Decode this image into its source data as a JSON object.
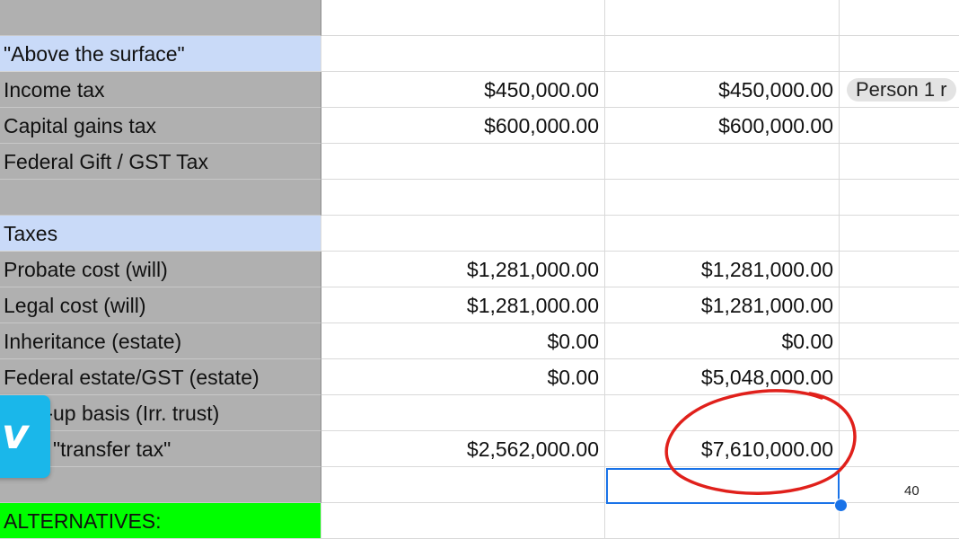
{
  "rows": [
    {
      "style": "gray",
      "label": "",
      "a": "",
      "b": "",
      "note": ""
    },
    {
      "style": "blue",
      "label": "\"Above the surface\"",
      "a": "",
      "b": "",
      "note": ""
    },
    {
      "style": "gray",
      "label": "Income tax",
      "a": "$450,000.00",
      "b": "$450,000.00",
      "note": "Person 1 r"
    },
    {
      "style": "gray",
      "label": "Capital gains tax",
      "a": "$600,000.00",
      "b": "$600,000.00",
      "note": ""
    },
    {
      "style": "gray",
      "label": "Federal Gift / GST Tax",
      "a": "",
      "b": "",
      "note": ""
    },
    {
      "style": "gray",
      "label": "",
      "a": "",
      "b": "",
      "note": ""
    },
    {
      "style": "blue",
      "label": "Taxes",
      "a": "",
      "b": "",
      "note": ""
    },
    {
      "style": "gray",
      "label": "Probate cost (will)",
      "a": "$1,281,000.00",
      "b": "$1,281,000.00",
      "note": ""
    },
    {
      "style": "gray",
      "label": "Legal cost (will)",
      "a": "$1,281,000.00",
      "b": "$1,281,000.00",
      "note": ""
    },
    {
      "style": "gray",
      "label": "Inheritance (estate)",
      "a": "$0.00",
      "b": "$0.00",
      "note": ""
    },
    {
      "style": "gray",
      "label": "Federal estate/GST (estate)",
      "a": "$0.00",
      "b": "$5,048,000.00",
      "note": ""
    },
    {
      "style": "gray",
      "label": "Step-up basis (Irr. trust)",
      "a": "",
      "b": "",
      "note": ""
    },
    {
      "style": "gray",
      "label": "Total \"transfer tax\"",
      "a": "$2,562,000.00",
      "b": "$7,610,000.00",
      "note": ""
    },
    {
      "style": "gray",
      "label": "",
      "a": "",
      "b": "",
      "note": ""
    },
    {
      "style": "green",
      "label": "ALTERNATIVES:",
      "a": "",
      "b": "",
      "note": ""
    }
  ],
  "page_number": "40",
  "vimeo": {
    "glyph": "v"
  },
  "colors": {
    "label_gray": "#b0b0b0",
    "section_blue": "#c9daf8",
    "alt_green": "#00ff00",
    "selection_blue": "#1a73e8",
    "annotation_red": "#e0201b"
  }
}
